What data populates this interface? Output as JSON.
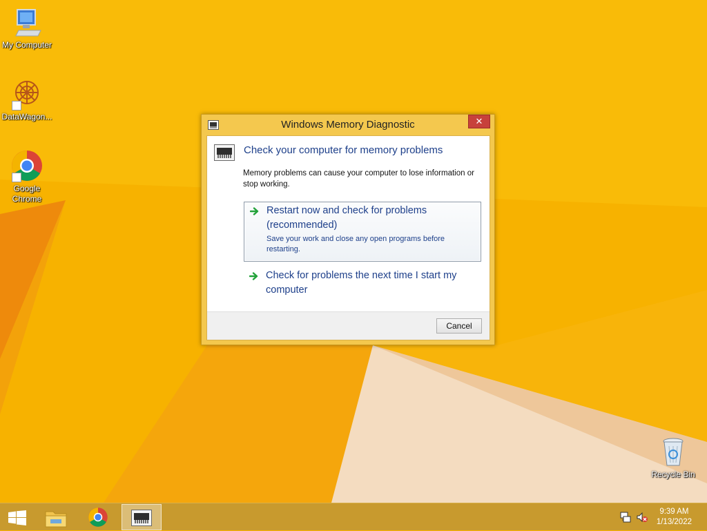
{
  "desktop": {
    "icons": [
      {
        "label": "My Computer",
        "icon": "computer-icon"
      },
      {
        "label": "DataWagon...",
        "icon": "datawagon-icon"
      },
      {
        "label": "Google Chrome",
        "icon": "chrome-icon"
      },
      {
        "label": "Recycle Bin",
        "icon": "recycle-bin-icon"
      }
    ],
    "chrome_label_line1": "Google",
    "chrome_label_line2": "Chrome"
  },
  "dialog": {
    "title": "Windows Memory Diagnostic",
    "close_glyph": "✕",
    "main_instruction": "Check your computer for memory problems",
    "content": "Memory problems can cause your computer to lose information or stop working.",
    "options": [
      {
        "title": "Restart now and check for problems (recommended)",
        "note": "Save your work and close any open programs before restarting.",
        "icon": "green-arrow-icon"
      },
      {
        "title": "Check for problems the next time I start my computer",
        "icon": "green-arrow-icon"
      }
    ],
    "cancel_label": "Cancel"
  },
  "taskbar": {
    "items": [
      "start-icon",
      "file-explorer-icon",
      "chrome-icon",
      "memory-diagnostic-icon"
    ],
    "tray": [
      "network-icon",
      "volume-muted-icon"
    ],
    "time": "9:39 AM",
    "date": "1/13/2022"
  },
  "colors": {
    "desktop": "#f7b200",
    "accent_text": "#1d3f8a",
    "close_button": "#c7413b",
    "taskbar": "#c89a2e"
  }
}
